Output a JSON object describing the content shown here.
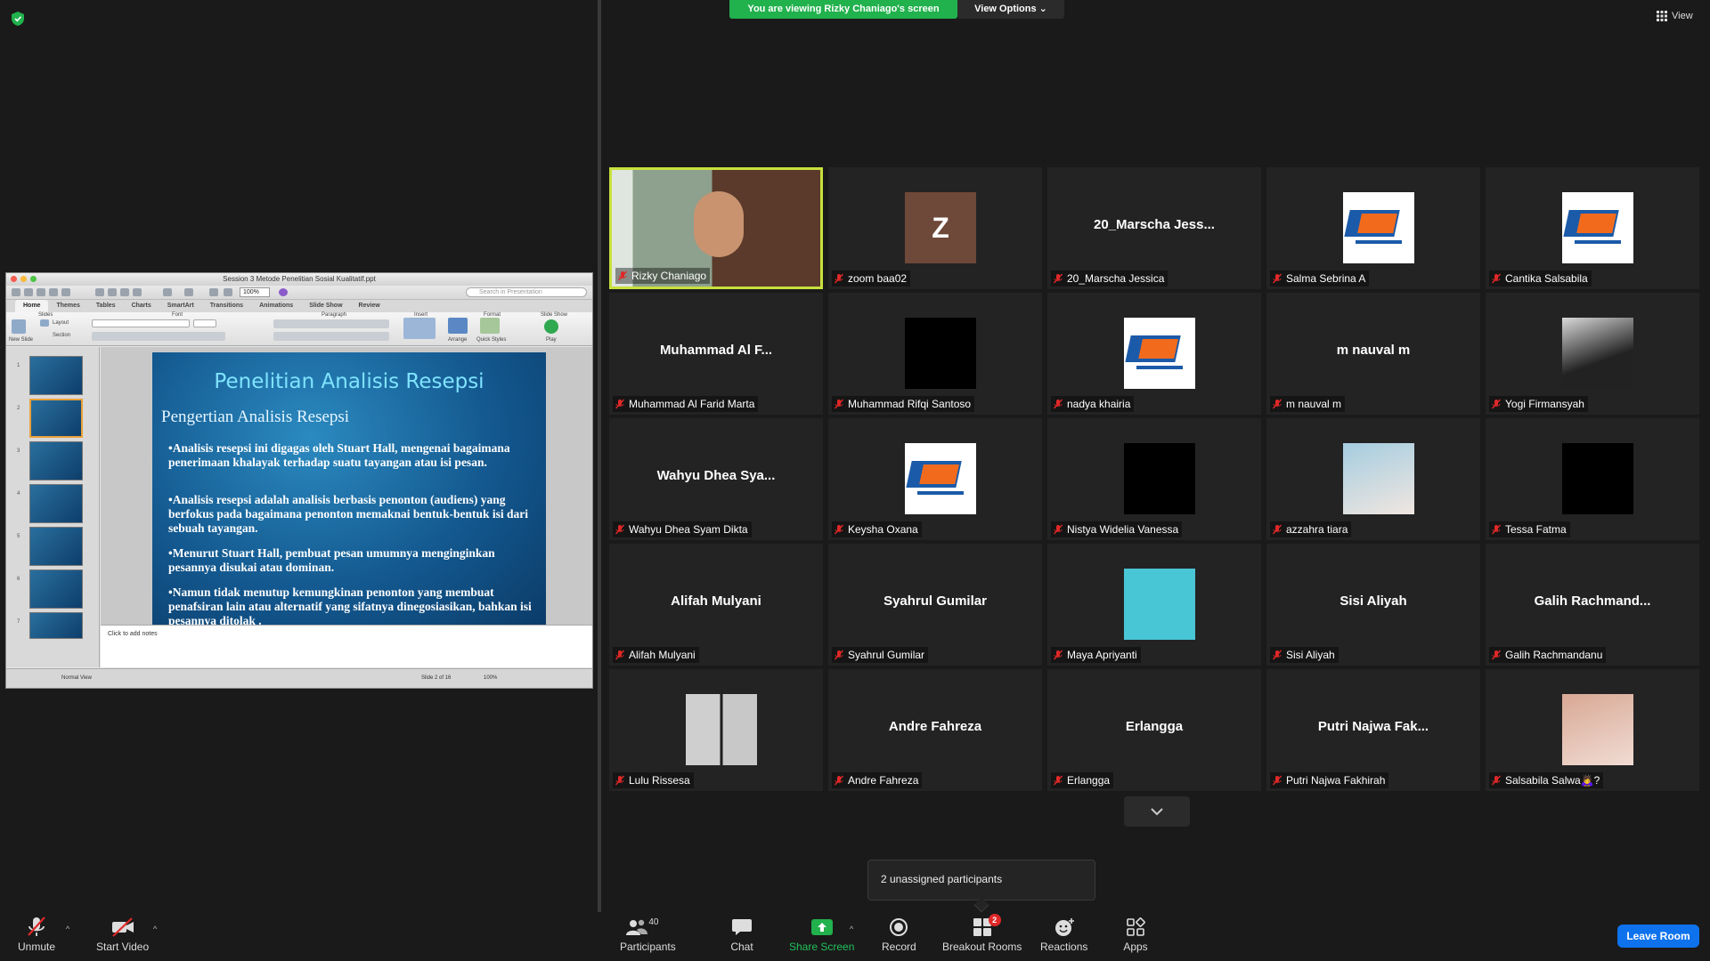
{
  "banner": {
    "viewing": "You are viewing Rizky Chaniago's screen",
    "view_options": "View Options ⌄",
    "view": "View"
  },
  "ppt": {
    "window_title": "Session 3 Metode Penelitian Sosial Kualitatif.ppt",
    "zoom": "100%",
    "search_placeholder": "Search in Presentation",
    "tabs": [
      "Home",
      "Themes",
      "Tables",
      "Charts",
      "SmartArt",
      "Transitions",
      "Animations",
      "Slide Show",
      "Review"
    ],
    "ribbon": {
      "new_slide": "New Slide",
      "layout": "Layout",
      "section": "Section",
      "arrange": "Arrange",
      "quick_styles": "Quick Styles",
      "play": "Play",
      "group_slides": "Slides",
      "group_font": "Font",
      "group_paragraph": "Paragraph",
      "group_insert": "Insert",
      "group_format": "Format",
      "group_slideshow": "Slide Show"
    },
    "thumb_numbers": [
      "1",
      "2",
      "3",
      "4",
      "5",
      "6",
      "7"
    ],
    "slide": {
      "title": "Penelitian Analisis Resepsi",
      "subtitle": "Pengertian Analisis Resepsi",
      "bullets": [
        "•Analisis resepsi ini digagas oleh Stuart Hall, mengenai bagaimana penerimaan khalayak terhadap suatu tayangan atau isi pesan.",
        "•Analisis resepsi adalah analisis berbasis penonton (audiens) yang  berfokus pada bagaimana penonton memaknai bentuk-bentuk isi dari  sebuah tayangan.",
        "•Menurut Stuart Hall, pembuat pesan umumnya menginginkan pesannya  disukai atau dominan.",
        "•Namun tidak menutup kemungkinan penonton yang membuat penafsiran lain atau alternatif yang sifatnya dinegosiasikan, bahkan isi  pesannya ditolak ."
      ]
    },
    "notes_placeholder": "Click to add notes",
    "status": {
      "view": "Normal View",
      "slide": "Slide 2 of 16",
      "zoom": "100%"
    }
  },
  "participants": [
    {
      "name": "Rizky Chaniago",
      "display": "",
      "avatar": "photo",
      "active": true
    },
    {
      "name": "zoom baa02",
      "display": "",
      "avatar": "Z"
    },
    {
      "name": "20_Marscha Jessica",
      "display": "20_Marscha Jess...",
      "avatar": ""
    },
    {
      "name": "Salma Sebrina A",
      "display": "",
      "avatar": "logo"
    },
    {
      "name": "Cantika Salsabila",
      "display": "",
      "avatar": "logo"
    },
    {
      "name": "Muhammad Al Farid Marta",
      "display": "Muhammad Al F...",
      "avatar": ""
    },
    {
      "name": "Muhammad Rifqi Santoso",
      "display": "",
      "avatar": "black"
    },
    {
      "name": "nadya khairia",
      "display": "",
      "avatar": "logo"
    },
    {
      "name": "m nauval m",
      "display": "m nauval m",
      "avatar": ""
    },
    {
      "name": "Yogi Firmansyah",
      "display": "",
      "avatar": "photo-dark"
    },
    {
      "name": "Wahyu Dhea Syam Dikta",
      "display": "Wahyu Dhea Sya...",
      "avatar": ""
    },
    {
      "name": "Keysha Oxana",
      "display": "",
      "avatar": "logo"
    },
    {
      "name": "Nistya Widelia Vanessa",
      "display": "",
      "avatar": "black"
    },
    {
      "name": "azzahra tiara",
      "display": "",
      "avatar": "photo-blue"
    },
    {
      "name": "Tessa Fatma",
      "display": "",
      "avatar": "black"
    },
    {
      "name": "Alifah Mulyani",
      "display": "Alifah Mulyani",
      "avatar": ""
    },
    {
      "name": "Syahrul Gumilar",
      "display": "Syahrul Gumilar",
      "avatar": ""
    },
    {
      "name": "Maya Apriyanti",
      "display": "",
      "avatar": "photo-giraffe"
    },
    {
      "name": "Sisi Aliyah",
      "display": "Sisi Aliyah",
      "avatar": ""
    },
    {
      "name": "Galih Rachmandanu",
      "display": "Galih  Rachmand...",
      "avatar": ""
    },
    {
      "name": "Lulu Rissesa",
      "display": "",
      "avatar": "photo-duo"
    },
    {
      "name": "Andre Fahreza",
      "display": "Andre Fahreza",
      "avatar": ""
    },
    {
      "name": "Erlangga",
      "display": "Erlangga",
      "avatar": ""
    },
    {
      "name": "Putri Najwa Fakhirah",
      "display": "Putri Najwa Fak...",
      "avatar": ""
    },
    {
      "name": "Salsabila Salwa🙇‍♀️?",
      "display": "",
      "avatar": "photo-pink"
    }
  ],
  "unassigned": "2 unassigned participants",
  "toolbar": {
    "unmute": "Unmute",
    "start_video": "Start Video",
    "participants": "Participants",
    "participants_count": "40",
    "chat": "Chat",
    "share_screen": "Share Screen",
    "record": "Record",
    "breakout_rooms": "Breakout Rooms",
    "breakout_badge": "2",
    "reactions": "Reactions",
    "apps": "Apps",
    "leave": "Leave Room"
  },
  "colors": {
    "share_green": "#21b14d",
    "leave_blue": "#0e72ed",
    "active_speaker": "#c8e03c",
    "badge_red": "#e02828"
  }
}
